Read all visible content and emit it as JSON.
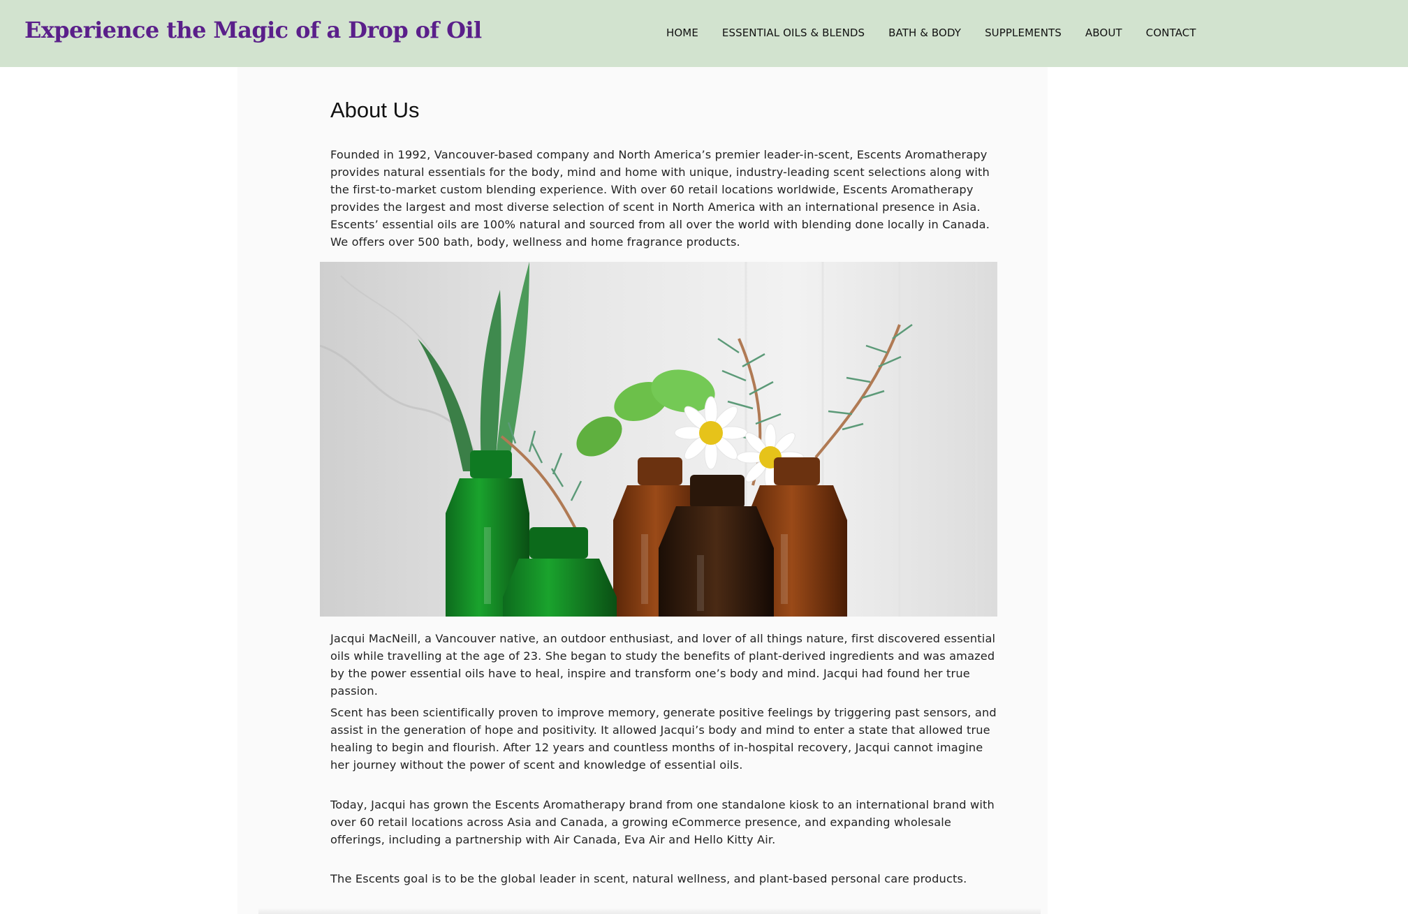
{
  "header": {
    "brand": "Experience the Magic of a Drop of Oil",
    "nav": [
      {
        "label": "HOME"
      },
      {
        "label": "ESSENTIAL OILS & BLENDS"
      },
      {
        "label": "BATH & BODY"
      },
      {
        "label": "SUPPLEMENTS"
      },
      {
        "label": "ABOUT"
      },
      {
        "label": "CONTACT"
      }
    ],
    "background_color": "#d2e3cf",
    "brand_color": "#5a1f8a"
  },
  "main": {
    "title": "About Us",
    "paragraphs": {
      "intro": "Founded in 1992, Vancouver-based company and North America’s premier leader-in-scent, Escents Aromatherapy provides natural essentials for the body, mind and home with unique, industry-leading scent selections along with the first-to-market custom blending experience. With over 60 retail locations worldwide, Escents Aromatherapy provides the largest and most diverse selection of scent in North America with an international presence in Asia. Escents’ essential oils are 100% natural and sourced from all over the world with blending done locally in Canada. We offers over 500 bath, body, wellness and home fragrance products.",
      "jacqui": "Jacqui MacNeill, a Vancouver native, an outdoor enthusiast, and lover of all things nature, first discovered essential oils while travelling at the age of 23. She began to study the benefits of plant-derived ingredients and was amazed by the power essential oils have to heal, inspire and transform one’s body and mind. Jacqui had found her true passion.",
      "scent": "Scent has been scientifically proven to improve memory, generate positive feelings by triggering past sensors, and assist in the generation of hope and positivity. It allowed Jacqui’s body and mind to enter a state that allowed true healing to begin and flourish. After 12 years and countless months of in-hospital recovery, Jacqui cannot imagine her journey without the power of scent and knowledge of essential oils.",
      "today": "Today, Jacqui has grown the Escents Aromatherapy brand from one standalone kiosk to an international brand with over 60 retail locations across Asia and Canada, a growing eCommerce presence, and expanding wholesale offerings, including a partnership with Air Canada, Eva Air and Hello Kitty Air.",
      "goal": "The Escents goal is to be the global leader in scent, natural wellness, and plant-based personal care products."
    },
    "hero_image": {
      "icon": "essential-oil-bottles-photo"
    }
  }
}
